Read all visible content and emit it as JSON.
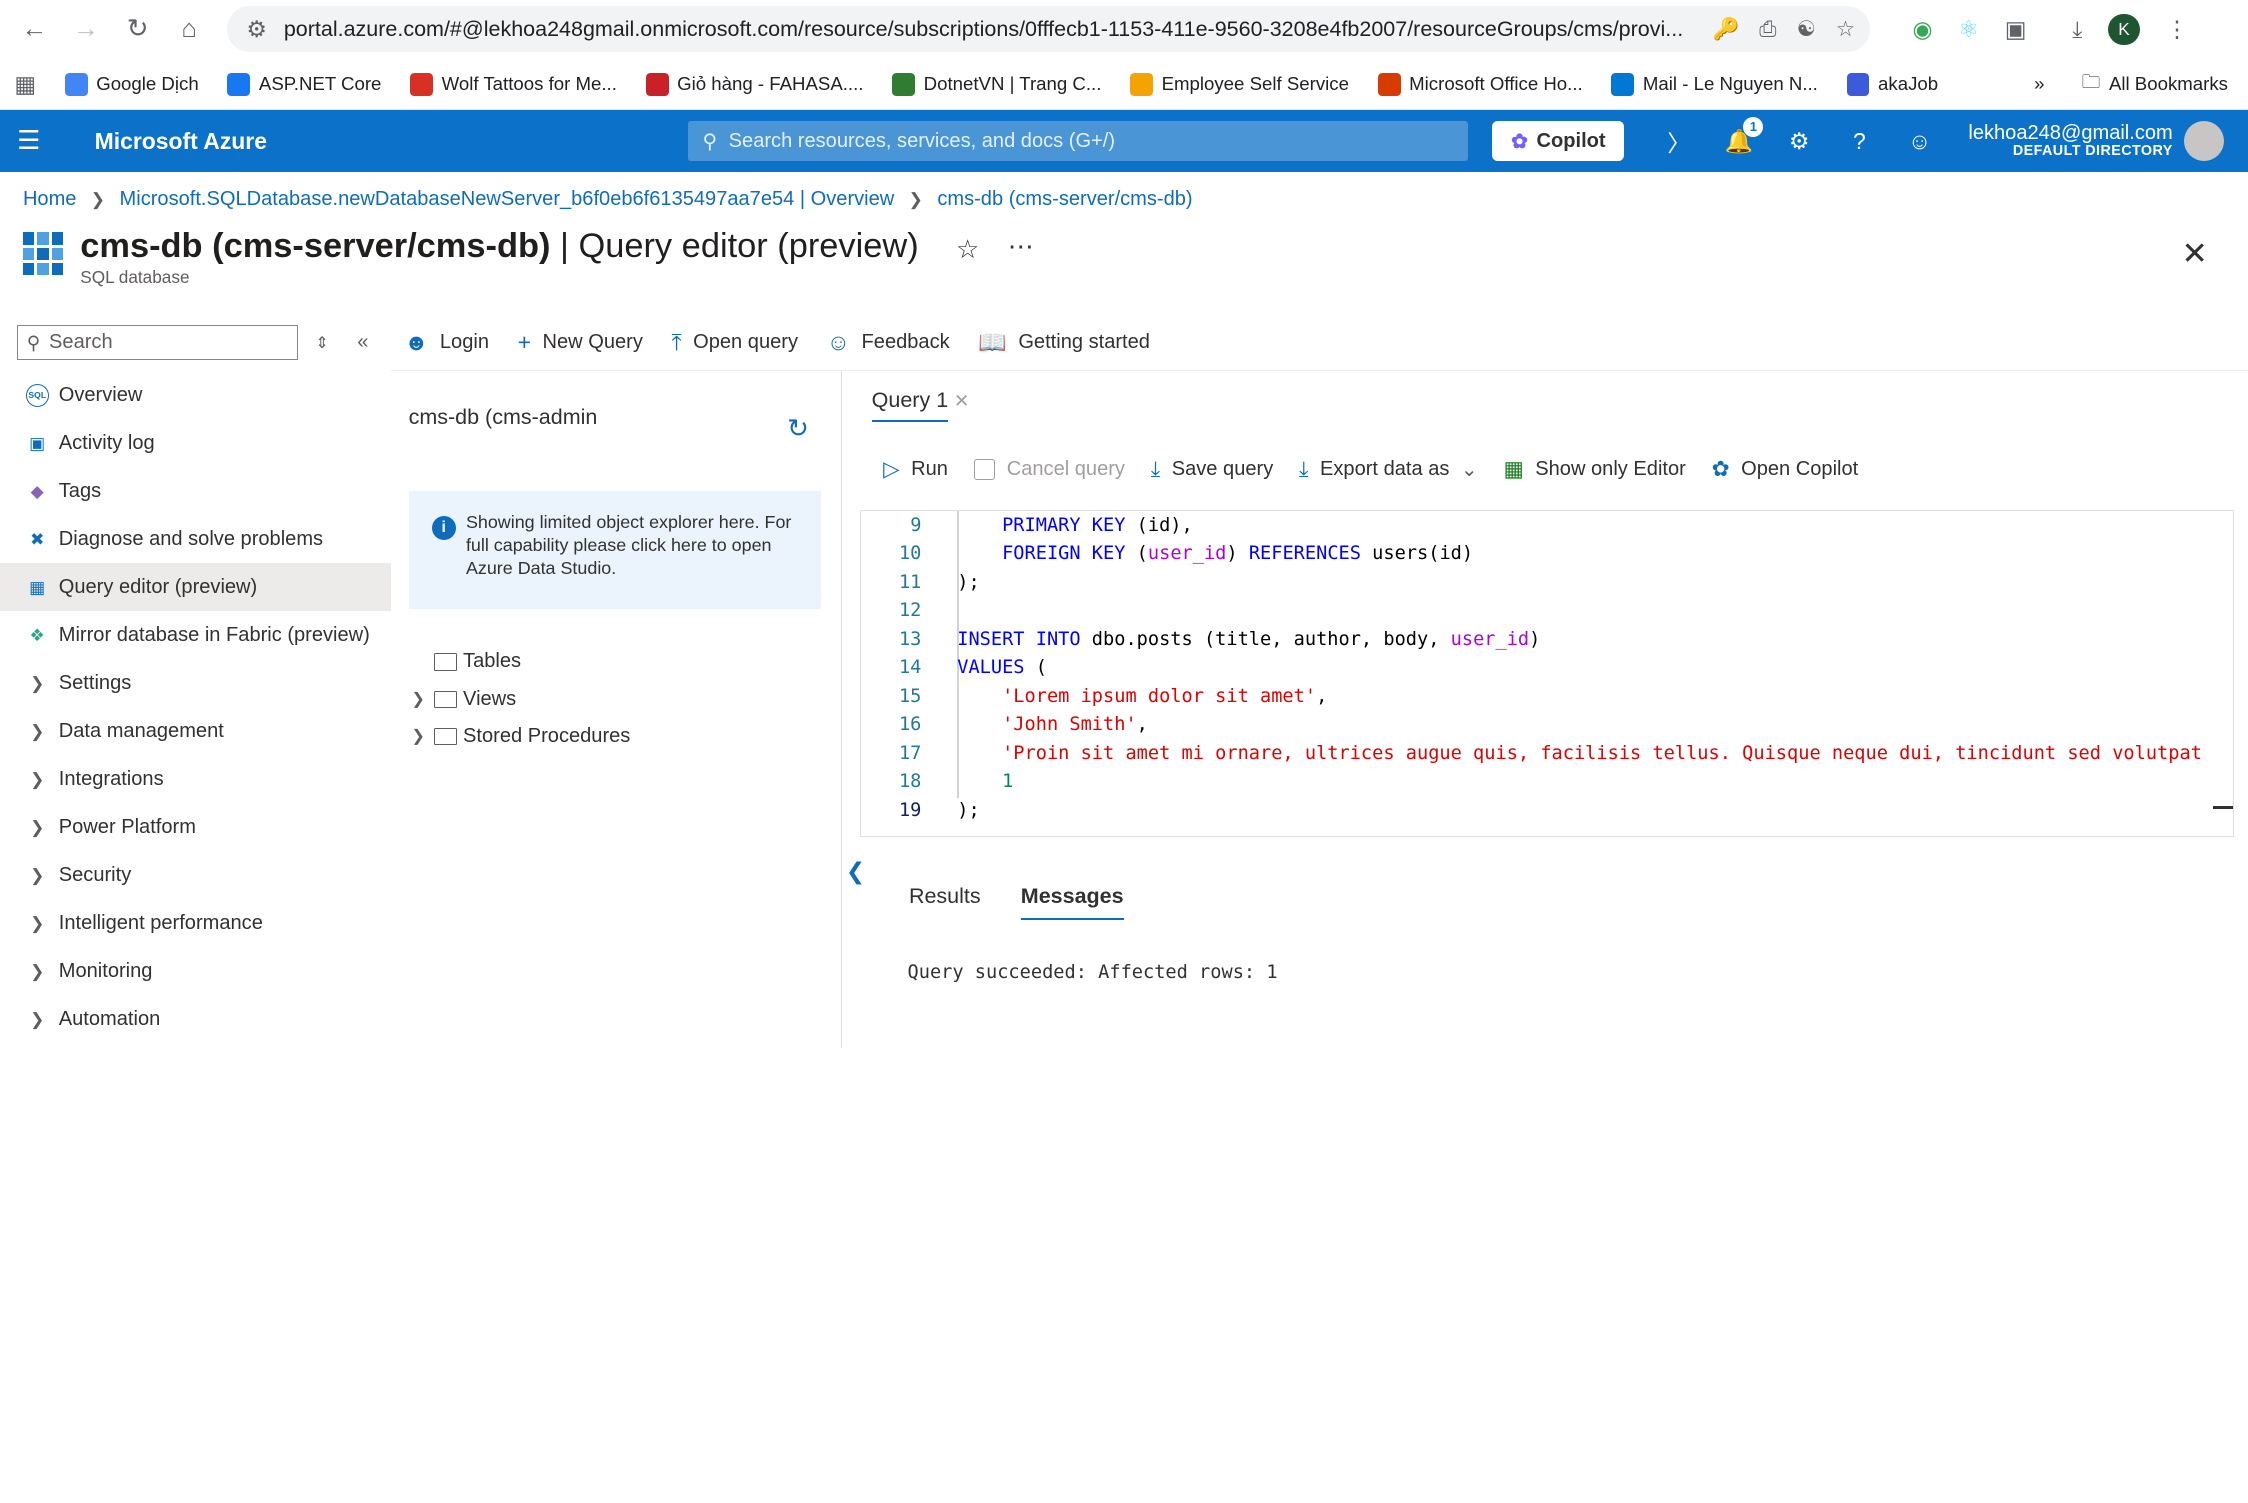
{
  "browser": {
    "url": "portal.azure.com/#@lekhoa248gmail.onmicrosoft.com/resource/subscriptions/0fffecb1-1153-411e-9560-3208e4fb2007/resourceGroups/cms/provi...",
    "profile_initial": "K",
    "bookmarks": [
      {
        "label": "Google Dịch",
        "color": "#4285f4"
      },
      {
        "label": "ASP.NET Core",
        "color": "#1877f2"
      },
      {
        "label": "Wolf Tattoos for Me...",
        "color": "#d93025"
      },
      {
        "label": "Giỏ hàng - FAHASA....",
        "color": "#c92127"
      },
      {
        "label": "DotnetVN | Trang C...",
        "color": "#2e7d32"
      },
      {
        "label": "Employee Self Service",
        "color": "#f4a300"
      },
      {
        "label": "Microsoft Office Ho...",
        "color": "#d83b01"
      },
      {
        "label": "Mail - Le Nguyen N...",
        "color": "#0078d4"
      },
      {
        "label": "akaJob",
        "color": "#3b5bdb"
      }
    ],
    "more_bookmarks": "»",
    "all_bookmarks": "All Bookmarks"
  },
  "header": {
    "brand": "Microsoft Azure",
    "search_placeholder": "Search resources, services, and docs (G+/)",
    "copilot": "Copilot",
    "notification_count": "1",
    "email": "lekhoa248@gmail.com",
    "directory": "DEFAULT DIRECTORY"
  },
  "breadcrumb": {
    "home": "Home",
    "server": "Microsoft.SQLDatabase.newDatabaseNewServer_b6f0eb6f6135497aa7e54 | Overview",
    "db": "cms-db (cms-server/cms-db)"
  },
  "title": {
    "name": "cms-db (cms-server/cms-db)",
    "suffix": " | Query editor (preview)",
    "subtitle": "SQL database"
  },
  "sidebar": {
    "search_placeholder": "Search",
    "items": [
      {
        "label": "Overview",
        "icon": "sql-icon",
        "expandable": false
      },
      {
        "label": "Activity log",
        "icon": "activity-log-icon",
        "expandable": false
      },
      {
        "label": "Tags",
        "icon": "tag-icon",
        "expandable": false
      },
      {
        "label": "Diagnose and solve problems",
        "icon": "wrench-icon",
        "expandable": false
      },
      {
        "label": "Query editor (preview)",
        "icon": "query-editor-icon",
        "expandable": false,
        "active": true
      },
      {
        "label": "Mirror database in Fabric (preview)",
        "icon": "fabric-icon",
        "expandable": false
      },
      {
        "label": "Settings",
        "expandable": true
      },
      {
        "label": "Data management",
        "expandable": true
      },
      {
        "label": "Integrations",
        "expandable": true
      },
      {
        "label": "Power Platform",
        "expandable": true
      },
      {
        "label": "Security",
        "expandable": true
      },
      {
        "label": "Intelligent performance",
        "expandable": true
      },
      {
        "label": "Monitoring",
        "expandable": true
      },
      {
        "label": "Automation",
        "expandable": true
      }
    ]
  },
  "command_bar": {
    "login": "Login",
    "new_query": "New Query",
    "open_query": "Open query",
    "feedback": "Feedback",
    "getting_started": "Getting started"
  },
  "object_explorer": {
    "title": "cms-db (cms-admin",
    "info": "Showing limited object explorer here. For full capability please click here to open Azure Data Studio.",
    "tree": [
      "Tables",
      "Views",
      "Stored Procedures"
    ]
  },
  "editor": {
    "tab": "Query 1",
    "toolbar": {
      "run": "Run",
      "cancel": "Cancel query",
      "save": "Save query",
      "export": "Export data as",
      "show_only_editor": "Show only Editor",
      "open_copilot": "Open Copilot"
    },
    "line_numbers": [
      "9",
      "10",
      "11",
      "12",
      "13",
      "14",
      "15",
      "16",
      "17",
      "18",
      "19"
    ],
    "code": {
      "l9a": "    ",
      "l9kw": "PRIMARY KEY",
      "l9b": " (id),",
      "l10a": "    ",
      "l10kw": "FOREIGN KEY",
      "l10b": " (",
      "l10fn": "user_id",
      "l10c": ") ",
      "l10kw2": "REFERENCES",
      "l10d": " users(id)",
      "l11": ");",
      "l13kw": "INSERT INTO",
      "l13a": " dbo.posts (title, author, body, ",
      "l13fn": "user_id",
      "l13b": ")",
      "l14kw": "VALUES",
      "l14a": " (",
      "l15s": "'Lorem ipsum dolor sit amet'",
      "l15a": ",",
      "l16s": "'John Smith'",
      "l16a": ",",
      "l17s": "'Proin sit amet mi ornare, ultrices augue quis, facilisis tellus. Quisque neque dui, tincidunt sed volutpat",
      "l18n": "1",
      "l19": ");"
    }
  },
  "results": {
    "tabs": [
      "Results",
      "Messages"
    ],
    "message": "Query succeeded: Affected rows: 1"
  }
}
